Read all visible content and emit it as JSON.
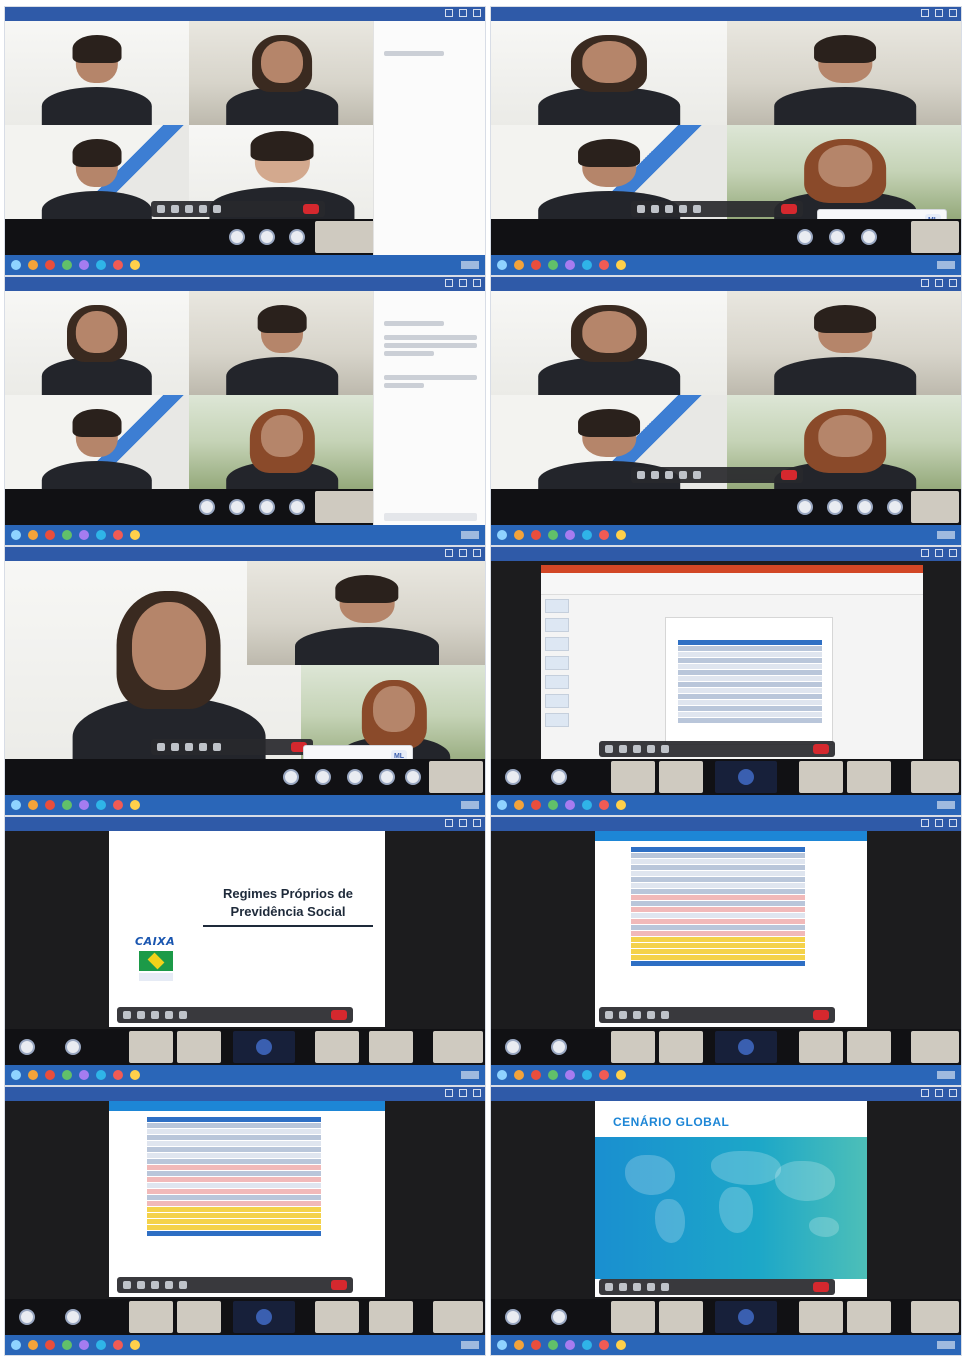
{
  "slides": {
    "title_line1": "Regimes Próprios de",
    "title_line2": "Previdência Social",
    "caixa_logo": "CAIXA",
    "global_title": "CENÁRIO GLOBAL"
  },
  "controls": {
    "participant_badge": "ML"
  },
  "colors": {
    "titlebar": "#2f5aa8",
    "taskbar": "#2a66b8",
    "hangup": "#d5282e",
    "caixa_blue": "#1a56b0",
    "ppt_ribbon": "#d24726",
    "table_yellow": "#f4d24a",
    "table_pink": "#f1b9b9"
  },
  "icons": {
    "mic": "microphone-icon",
    "camera": "camera-icon",
    "share": "share-screen-icon",
    "chat": "chat-icon",
    "hangup": "hang-up-icon",
    "more": "more-options-icon"
  }
}
